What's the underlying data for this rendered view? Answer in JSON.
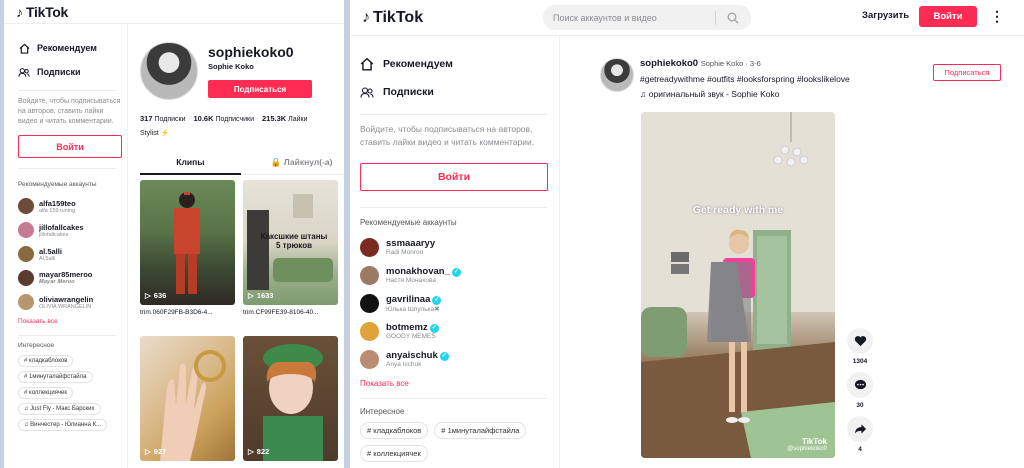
{
  "brand": {
    "name": "TikTok",
    "accent": "#fe2c55"
  },
  "left": {
    "nav": [
      {
        "icon": "home-icon",
        "label": "Рекомендуем"
      },
      {
        "icon": "following-icon",
        "label": "Подписки"
      }
    ],
    "login_hint": "Войдите, чтобы подписываться на авторов, ставить лайки видео и читать комментарии.",
    "login_button": "Войти",
    "suggested_title": "Рекомендуемые аккаунты",
    "accounts": [
      {
        "username": "alfa159teo",
        "name": "alfa 159 tuning",
        "color": "#6b4b3a"
      },
      {
        "username": "jillofallcakes",
        "name": "jillofallcakes",
        "color": "#c57b92"
      },
      {
        "username": "al.5alli",
        "name": "Al.5alli",
        "color": "#8a6a3c"
      },
      {
        "username": "mayar85meroo",
        "name": "𝑴𝒂𝒚𝒂𝒓 𝑴𝒆𝒓𝒐𝒐",
        "color": "#5b3b2b"
      },
      {
        "username": "oliviawrangelin",
        "name": "OLIVIA WRANGELIN",
        "color": "#b89770"
      }
    ],
    "show_all": "Показать все",
    "interesting_title": "Интересное",
    "tags": [
      {
        "icon": "hashtag-icon",
        "label": "кладкаблоков"
      },
      {
        "icon": "hashtag-icon",
        "label": "1минуталайфстайла"
      },
      {
        "icon": "hashtag-icon",
        "label": "коллекциячек"
      },
      {
        "icon": "music-icon",
        "label": "Just Fly - Макс Барских"
      },
      {
        "icon": "music-icon",
        "label": "Винчестер - Юлианна К..."
      }
    ],
    "profile": {
      "username": "sophiekoko0",
      "name": "Sophie Koko",
      "follow": "Подписаться",
      "following_count": "317",
      "following_label": "Подписки",
      "followers_count": "10.6K",
      "followers_label": "Подписчики",
      "likes_count": "215.3K",
      "likes_label": "Лайки",
      "bio": "Stylist ⚡"
    },
    "tabs": {
      "clips": "Клипы",
      "liked": "Лайкнул(-а)"
    },
    "videos": [
      {
        "views": "636",
        "caption": "trim.060F29FB-B3D6-4..."
      },
      {
        "views": "1633",
        "caption": "trim.CF99FE39-8106-40...",
        "overlay": "Каксшкие штаны 5 трюков"
      },
      {
        "views": "927",
        "caption": ""
      },
      {
        "views": "822",
        "caption": ""
      }
    ]
  },
  "right": {
    "search_placeholder": "Поиск аккаунтов и видео",
    "upload": "Загрузить",
    "login_button": "Войти",
    "nav": [
      {
        "icon": "home-icon",
        "label": "Рекомендуем"
      },
      {
        "icon": "following-icon",
        "label": "Подписки"
      }
    ],
    "login_hint": "Войдите, чтобы подписываться на авторов, ставить лайки видео и читать комментарии.",
    "suggested_title": "Рекомендуемые аккаунты",
    "accounts": [
      {
        "username": "ssmaaaryy",
        "name": "Radi Monroo",
        "verified": false,
        "color": "#7a2c22"
      },
      {
        "username": "monakhovan_",
        "name": "Настя Монахова",
        "verified": true,
        "color": "#9c7a66"
      },
      {
        "username": "gavrilinaa",
        "name": "Юлька Шпулька✖",
        "verified": true,
        "color": "#111111"
      },
      {
        "username": "botmemz",
        "name": "GOODY MEMES",
        "verified": true,
        "color": "#e0a33a"
      },
      {
        "username": "anyaischuk",
        "name": "Anya Ischuk",
        "verified": true,
        "color": "#b88d73"
      }
    ],
    "show_all": "Показать все",
    "interesting_title": "Интересное",
    "tags": [
      {
        "icon": "hashtag-icon",
        "label": "кладкаблоков"
      },
      {
        "icon": "hashtag-icon",
        "label": "1минуталайфстайла"
      },
      {
        "icon": "hashtag-icon",
        "label": "коллекциячек"
      }
    ],
    "post": {
      "username": "sophiekoko0",
      "name_date": "Sophie Koko · 3-6",
      "description": "#getreadywithme #outfits #looksforspring #lookslikelove",
      "sound": "оригинальный звук - Sophie Koko",
      "follow": "Подписаться",
      "video_text": "Get ready with me",
      "watermark": "TikTok",
      "watermark_user": "@sophiekoko0",
      "likes": "1304",
      "comments": "30",
      "shares": "4"
    }
  }
}
